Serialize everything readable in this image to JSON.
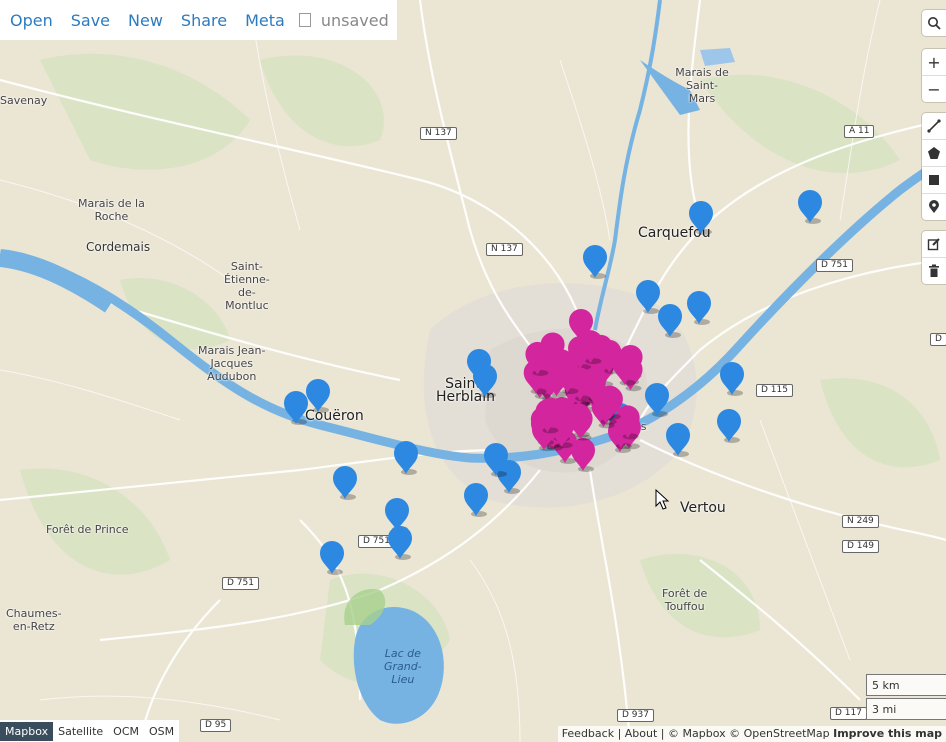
{
  "menu": {
    "items": [
      "Open",
      "Save",
      "New",
      "Share",
      "Meta"
    ],
    "status": "unsaved"
  },
  "places": [
    {
      "text": "Savenay",
      "cls": "small"
    },
    {
      "text": "Marais de Saint-\nMars",
      "cls": "small"
    },
    {
      "text": "Marais de la\nRoche",
      "cls": "small"
    },
    {
      "text": "Cordemais",
      "cls": "small"
    },
    {
      "text": "Saint-\nÉtienne-\nde-\nMontluc",
      "cls": "small"
    },
    {
      "text": "Marais Jean-\nJacques\nAudubon",
      "cls": "small"
    },
    {
      "text": "Couëron",
      "cls": "big"
    },
    {
      "text": "Saint-\nHerblain",
      "cls": "big"
    },
    {
      "text": "Carquefou",
      "cls": "big"
    },
    {
      "text": "Vertou",
      "cls": "big"
    },
    {
      "text": "Forêt de Prince",
      "cls": "small"
    },
    {
      "text": "Chaumes-\nen-Retz",
      "cls": "small"
    },
    {
      "text": "Forêt de\nTouffou",
      "cls": "small"
    },
    {
      "text": "Lac de\nGrand-\nLieu",
      "cls": "lake"
    },
    {
      "text": "es",
      "cls": "small"
    }
  ],
  "shields": [
    "N 137",
    "N 137",
    "A 11",
    "D 751",
    "D 115",
    "N 249",
    "D 149",
    "D 751",
    "D 751",
    "D 937",
    "D 95",
    "D 117",
    "D"
  ],
  "controls": {
    "search": "search-icon",
    "zoom_in": "+",
    "zoom_out": "−",
    "draw": [
      "line-icon",
      "polygon-icon",
      "rectangle-icon",
      "marker-icon"
    ],
    "edit": [
      "edit-icon",
      "trash-icon"
    ]
  },
  "scale": {
    "km": "5 km",
    "mi": "3 mi"
  },
  "layers": {
    "options": [
      "Mapbox",
      "Satellite",
      "OCM",
      "OSM"
    ],
    "active": "Mapbox"
  },
  "attribution": {
    "feedback": "Feedback",
    "about": "About",
    "copy": "© Mapbox © OpenStreetMap",
    "improve": "Improve this map"
  },
  "markers": {
    "blue_color": "#2c88e0",
    "magenta_color": "#d3259e",
    "blue_count": 24,
    "magenta_count": 60
  }
}
